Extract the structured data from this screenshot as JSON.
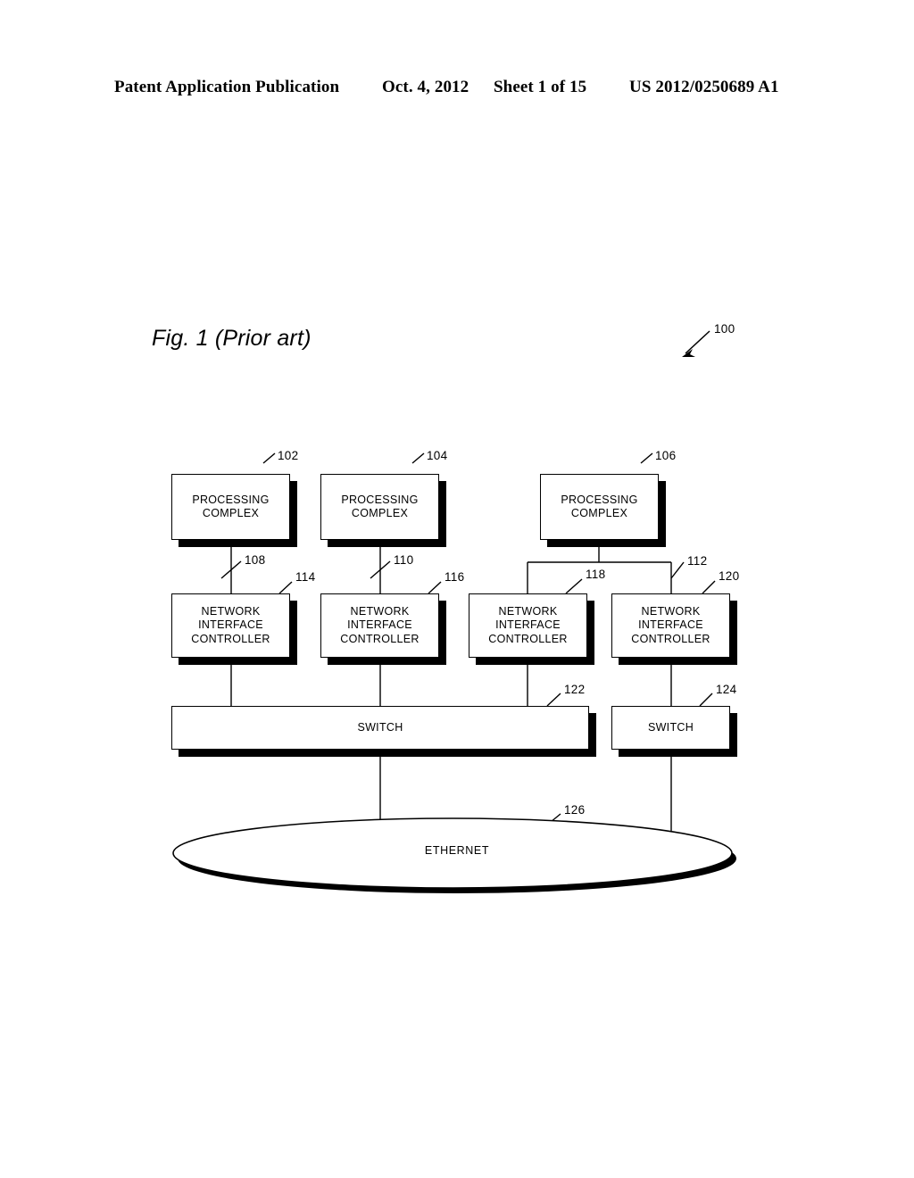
{
  "header": {
    "publication": "Patent Application Publication",
    "date": "Oct. 4, 2012",
    "sheet": "Sheet 1 of 15",
    "patent_number": "US 2012/0250689 A1"
  },
  "figure": {
    "caption": "Fig. 1 (Prior art)",
    "system_ref": "100",
    "ethernet_label": "ETHERNET"
  },
  "nodes": {
    "processing_complexes": [
      {
        "ref": "102",
        "label": "PROCESSING\nCOMPLEX"
      },
      {
        "ref": "104",
        "label": "PROCESSING\nCOMPLEX"
      },
      {
        "ref": "106",
        "label": "PROCESSING\nCOMPLEX"
      }
    ],
    "network_interface_controllers": [
      {
        "ref": "114",
        "label": "NETWORK\nINTERFACE\nCONTROLLER"
      },
      {
        "ref": "116",
        "label": "NETWORK\nINTERFACE\nCONTROLLER"
      },
      {
        "ref": "118",
        "label": "NETWORK\nINTERFACE\nCONTROLLER"
      },
      {
        "ref": "120",
        "label": "NETWORK\nINTERFACE\nCONTROLLER"
      }
    ],
    "switches": [
      {
        "ref": "122",
        "label": "SWITCH"
      },
      {
        "ref": "124",
        "label": "SWITCH"
      }
    ],
    "network": {
      "ref": "126",
      "label": "ETHERNET"
    }
  },
  "links": [
    {
      "ref": "108",
      "from": "102",
      "to": "114"
    },
    {
      "ref": "110",
      "from": "104",
      "to": "116"
    },
    {
      "ref": "112",
      "from": "106",
      "to": "120"
    },
    {
      "ref": "118",
      "from": "106",
      "to": "118"
    }
  ],
  "colors": {
    "ink": "#000000",
    "paper": "#ffffff"
  }
}
